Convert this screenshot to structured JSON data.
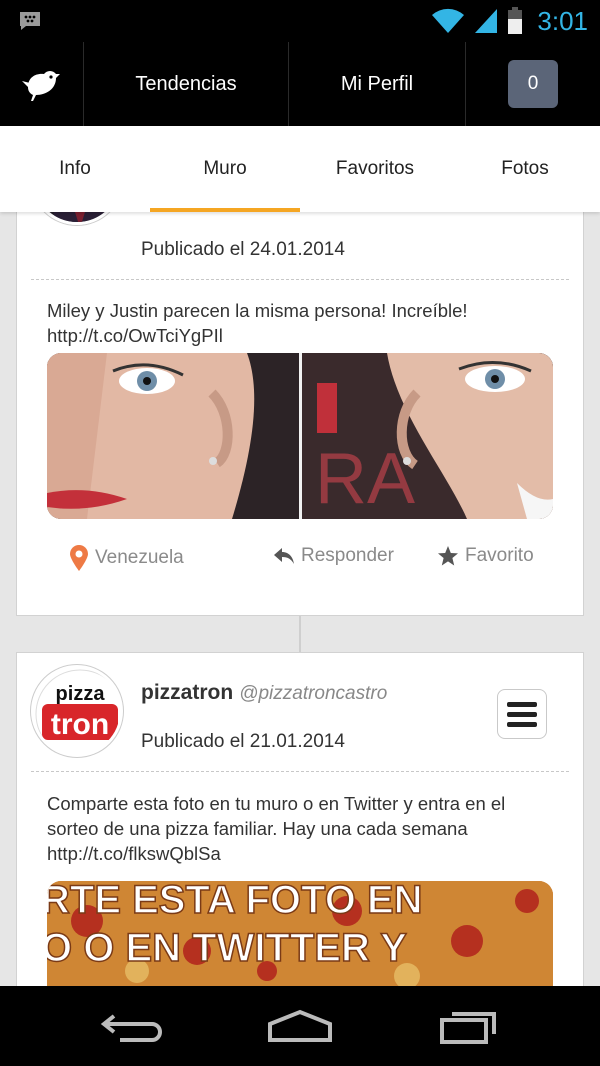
{
  "status_bar": {
    "time": "3:01",
    "colors": {
      "accent": "#33b5e5"
    }
  },
  "app_bar": {
    "logo_icon": "bird-icon",
    "nav": [
      "Tendencias",
      "Mi Perfil"
    ],
    "notification_count": "0"
  },
  "tabs": [
    {
      "label": "Info",
      "active": false
    },
    {
      "label": "Muro",
      "active": true
    },
    {
      "label": "Favoritos",
      "active": false
    },
    {
      "label": "Fotos",
      "active": false
    }
  ],
  "accent_color": "#f5a623",
  "posts": [
    {
      "date": "Publicado el 24.01.2014",
      "text": "Miley y Justin parecen la misma persona! Increíble! http://t.co/OwTciYgPIl",
      "location": "Venezuela",
      "reply_label": "Responder",
      "favorite_label": "Favorito"
    },
    {
      "name": "pizzatron",
      "handle": "@pizzatroncastro",
      "date": "Publicado el 21.01.2014",
      "text": "Comparte esta foto en tu muro o en Twitter y entra en el sorteo de una pizza familiar. Hay una cada semana http://t.co/flkswQblSa",
      "avatar_logo_text_top": "pizza",
      "avatar_logo_text_bottom": "tron",
      "image_text_lines": [
        "RTE ESTA FOTO EN",
        "O O EN TWITTER Y"
      ]
    }
  ]
}
